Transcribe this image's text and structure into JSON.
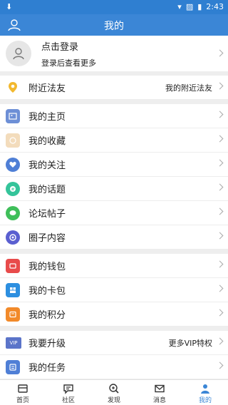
{
  "status": {
    "time": "2:43"
  },
  "header": {
    "title": "我的"
  },
  "profile": {
    "login_text": "点击登录",
    "sub_text": "登录后查看更多"
  },
  "nearby": {
    "label": "附近法友",
    "right": "我的附近法友"
  },
  "menu_group_1": [
    {
      "label": "我的主页",
      "icon": "home-card-icon",
      "color": "#6d8fd6"
    },
    {
      "label": "我的收藏",
      "icon": "favorite-icon",
      "color": "#e9c79a"
    },
    {
      "label": "我的关注",
      "icon": "heart-icon",
      "color": "#4f7fd6"
    },
    {
      "label": "我的话题",
      "icon": "topic-icon",
      "color": "#34c49a"
    },
    {
      "label": "论坛帖子",
      "icon": "chat-icon",
      "color": "#3fbf5a"
    },
    {
      "label": "圈子内容",
      "icon": "circle-icon",
      "color": "#5a5fd0"
    }
  ],
  "menu_group_2": [
    {
      "label": "我的钱包",
      "icon": "wallet-icon",
      "color": "#e84b4b"
    },
    {
      "label": "我的卡包",
      "icon": "card-icon",
      "color": "#2d8fe0"
    },
    {
      "label": "我的积分",
      "icon": "points-icon",
      "color": "#f28a2a"
    }
  ],
  "menu_group_3": [
    {
      "label": "我要升级",
      "icon": "vip-icon",
      "color": "#5b74c9",
      "right": "更多VIP特权"
    },
    {
      "label": "我的任务",
      "icon": "task-icon",
      "color": "#4f7fd6"
    }
  ],
  "tabs": [
    {
      "label": "首页",
      "icon": "home-icon"
    },
    {
      "label": "社区",
      "icon": "community-icon"
    },
    {
      "label": "发现",
      "icon": "discover-icon"
    },
    {
      "label": "消息",
      "icon": "message-icon"
    },
    {
      "label": "我的",
      "icon": "me-icon",
      "active": true
    }
  ]
}
